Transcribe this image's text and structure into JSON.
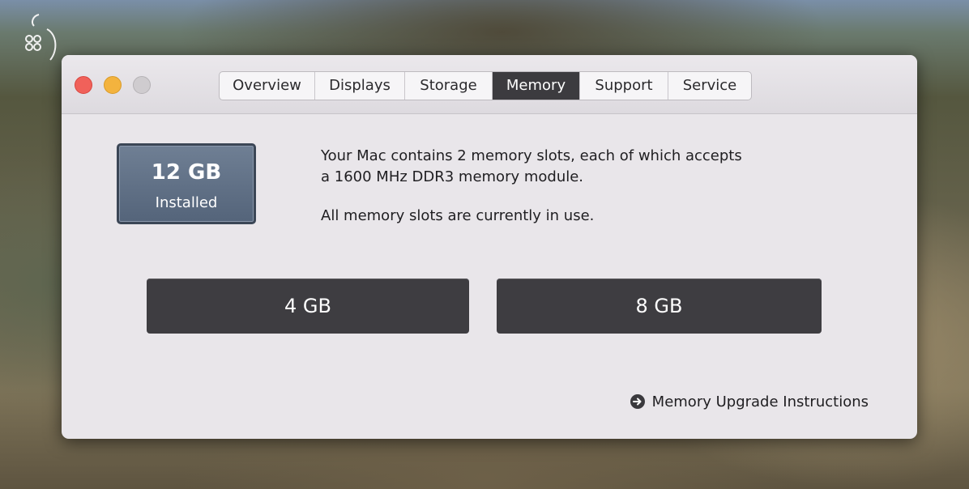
{
  "window": {
    "traffic_lights": {
      "close": "#f0615a",
      "minimize": "#f3b33e",
      "zoom": "#cfcccf"
    }
  },
  "tabs": [
    {
      "label": "Overview",
      "active": false
    },
    {
      "label": "Displays",
      "active": false
    },
    {
      "label": "Storage",
      "active": false
    },
    {
      "label": "Memory",
      "active": true
    },
    {
      "label": "Support",
      "active": false
    },
    {
      "label": "Service",
      "active": false
    }
  ],
  "memory": {
    "installed_size": "12 GB",
    "installed_label": "Installed",
    "description_line1": "Your Mac contains 2 memory slots, each of which accepts",
    "description_line2": "a 1600 MHz DDR3 memory module.",
    "status": "All memory slots are currently in use.",
    "slots": [
      {
        "label": "4 GB"
      },
      {
        "label": "8 GB"
      }
    ],
    "upgrade_link": "Memory Upgrade Instructions",
    "upgrade_icon": "arrow-circle-right-icon"
  },
  "colors": {
    "active_tab": "#3c3b3f",
    "installed_box": "#5f6f85",
    "slot": "#3e3d41"
  }
}
